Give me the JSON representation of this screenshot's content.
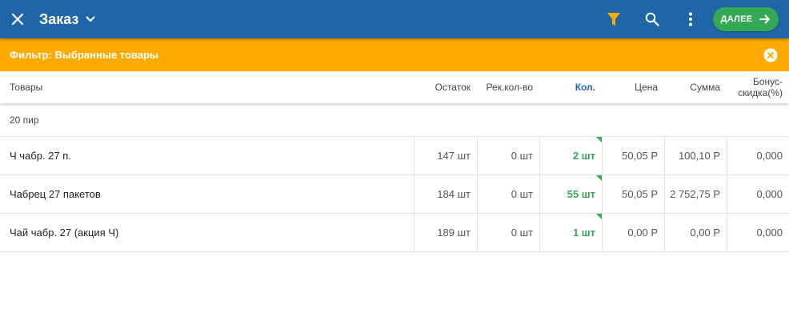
{
  "appbar": {
    "title": "Заказ",
    "next_label": "ДАЛЕЕ",
    "colors": {
      "bar": "#1f66a8",
      "filter_icon": "#fdab00",
      "next_button": "#34a853"
    }
  },
  "filter": {
    "text": "Фильтр: Выбранные товары",
    "color": "#fdab00"
  },
  "table": {
    "headers": {
      "name": "Товары",
      "stock": "Остаток",
      "recommended": "Рек.кол-во",
      "qty": "Кол.",
      "price": "Цена",
      "sum": "Сумма",
      "bonus_line1": "Бонус-",
      "bonus_line2": "скидка(%)"
    },
    "group": "20 пир",
    "rows": [
      {
        "name": "Ч чабр. 27 п.",
        "stock": "147 шт",
        "recommended": "0 шт",
        "qty": "2 шт",
        "price": "50,05 Р",
        "sum": "100,10 Р",
        "bonus": "0,000"
      },
      {
        "name": "Чабрец 27 пакетов",
        "stock": "184 шт",
        "recommended": "0 шт",
        "qty": "55 шт",
        "price": "50,05 Р",
        "sum": "2 752,75 Р",
        "bonus": "0,000"
      },
      {
        "name": "Чай чабр. 27 (акция Ч)",
        "stock": "189 шт",
        "recommended": "0 шт",
        "qty": "1 шт",
        "price": "0,00 Р",
        "sum": "0,00 Р",
        "bonus": "0,000"
      }
    ]
  }
}
